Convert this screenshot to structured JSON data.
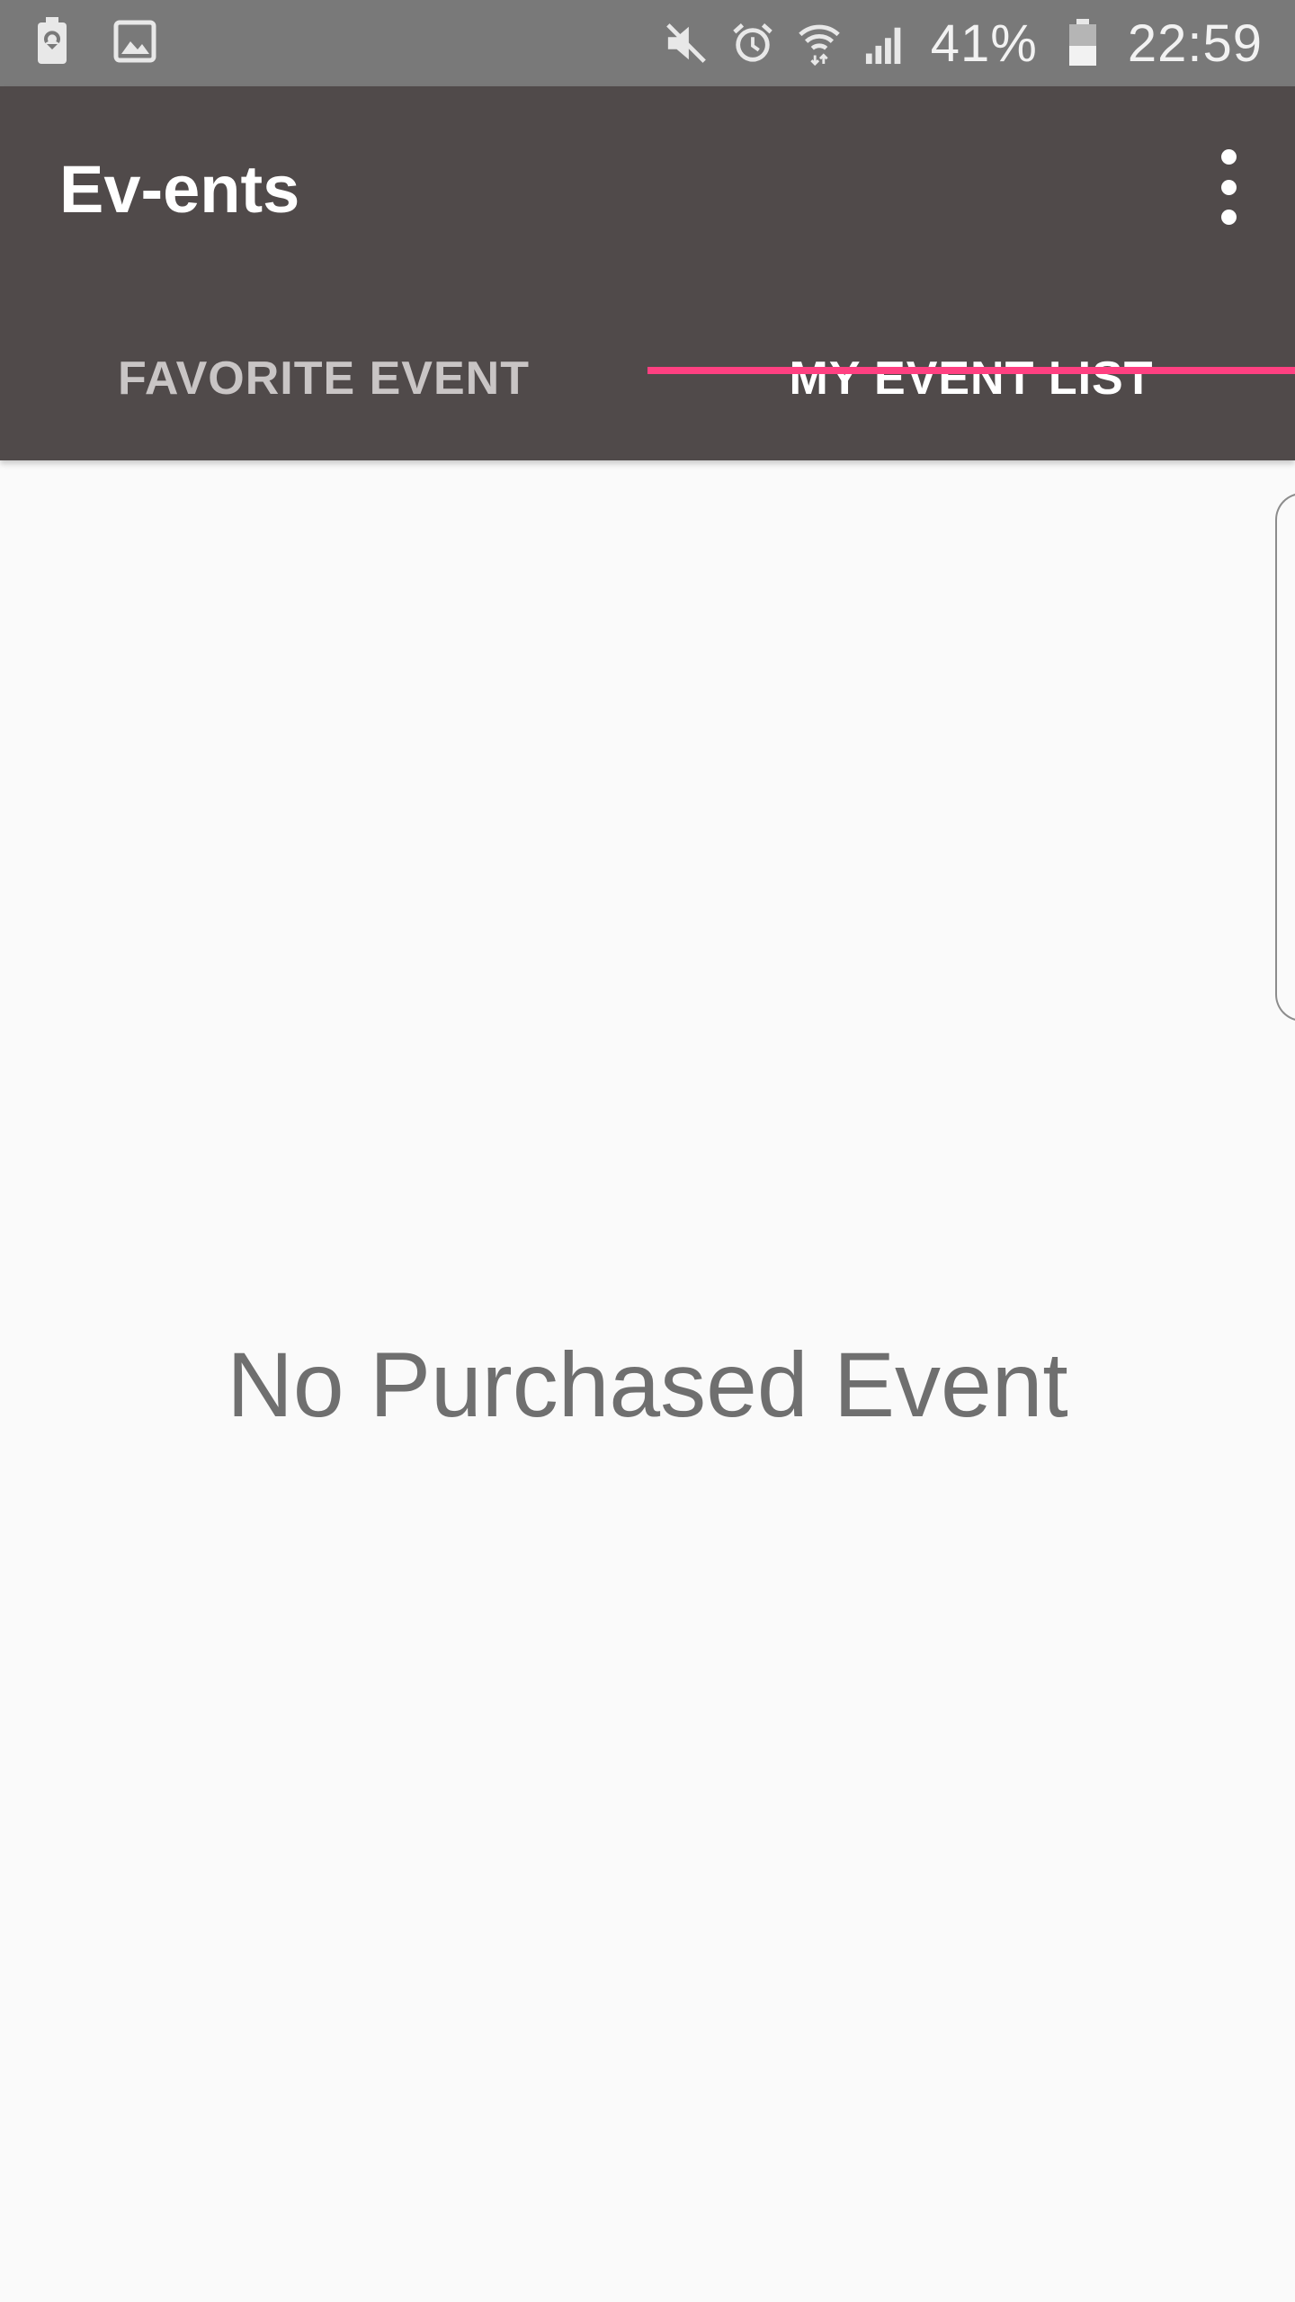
{
  "status_bar": {
    "left_icons": [
      "battery-saver-icon",
      "image-icon"
    ],
    "right_icons": [
      "mute-icon",
      "alarm-icon",
      "wifi-icon",
      "signal-icon"
    ],
    "battery_percent": "41%",
    "time": "22:59"
  },
  "app_bar": {
    "title": "Ev-ents",
    "overflow_icon": "more-vert-icon"
  },
  "tabs": [
    {
      "label": "FAVORITE EVENT",
      "selected": false
    },
    {
      "label": "MY EVENT LIST",
      "selected": true
    }
  ],
  "content": {
    "empty_message": "No Purchased Event"
  },
  "colors": {
    "status_bar": "#797979",
    "app_bar": "#504a4a",
    "tab_indicator": "#ff4081",
    "background": "#fafafa"
  }
}
